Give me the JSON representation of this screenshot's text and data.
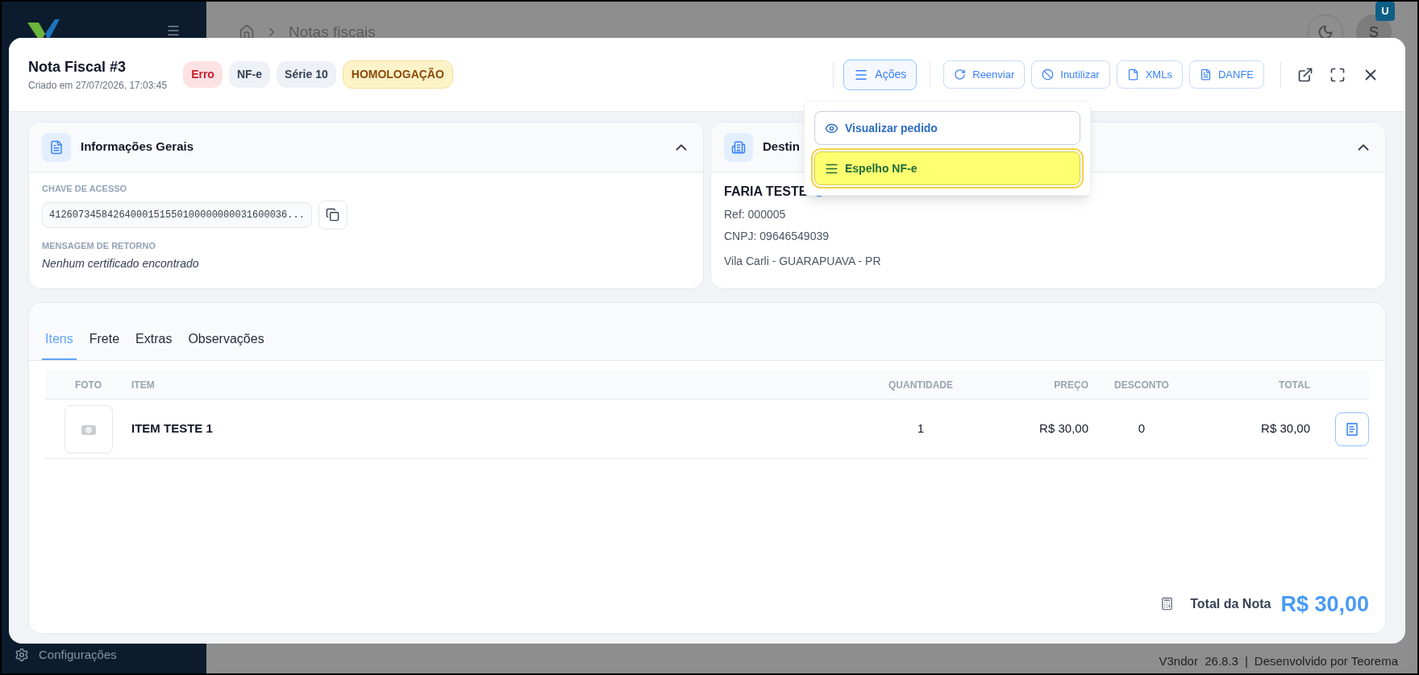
{
  "app": {
    "breadcrumb": "Notas fiscais",
    "avatar_initial": "S",
    "avatar_badge": "U",
    "sidebar_item": "Configurações",
    "footer": {
      "version": "V3ndor  26.8.3",
      "separator": "|",
      "credit": "Desenvolvido por Teorema"
    }
  },
  "modal": {
    "title": "Nota Fiscal #3",
    "subtitle": "Criado em 27/07/2026, 17:03:45",
    "badges": [
      {
        "label": "Erro",
        "kind": "error"
      },
      {
        "label": "NF-e",
        "kind": "neutral"
      },
      {
        "label": "Série 10",
        "kind": "neutral"
      },
      {
        "label": "HOMOLOGAÇÃO",
        "kind": "warning"
      }
    ],
    "menu_button": {
      "label": "Ações",
      "expanded": true
    },
    "actions": [
      {
        "label": "Reenviar",
        "kind": "resend"
      },
      {
        "label": "Inutilizar",
        "kind": "void"
      },
      {
        "label": "XMLs",
        "kind": "file"
      },
      {
        "label": "DANFE",
        "kind": "pdf"
      }
    ],
    "menu_items": [
      {
        "label": "Visualizar pedido",
        "kind": "view",
        "highlighted": false
      },
      {
        "label": "Espelho NF-e",
        "kind": "list",
        "highlighted": true
      }
    ],
    "general_card": {
      "title": "Informações Gerais",
      "expanded": true,
      "access_key_label": "CHAVE DE ACESSO",
      "access_key": "41260734584264000151550100000000031600036...",
      "return_label": "MENSAGEM DE RETORNO",
      "return_message": "Nenhum certificado encontrado"
    },
    "recipient_card": {
      "title": "Destin",
      "expanded": true,
      "name": "FARIA TESTE",
      "ref": "Ref: 000005",
      "cnpj": "CNPJ: 09646549039",
      "address": "Vila Carli - GUARAPUAVA - PR"
    },
    "tabs": [
      {
        "label": "Itens",
        "selected": true
      },
      {
        "label": "Frete",
        "selected": false
      },
      {
        "label": "Extras",
        "selected": false
      },
      {
        "label": "Observações",
        "selected": false
      }
    ],
    "table": {
      "columns": [
        "FOTO",
        "ITEM",
        "QUANTIDADE",
        "PREÇO",
        "DESCONTO",
        "TOTAL"
      ],
      "rows": [
        {
          "item": "ITEM TESTE 1",
          "quantity": "1",
          "price": "R$ 30,00",
          "discount": "0",
          "total": "R$ 30,00"
        }
      ]
    },
    "total": {
      "label": "Total da Nota",
      "value": "R$ 30,00"
    }
  }
}
